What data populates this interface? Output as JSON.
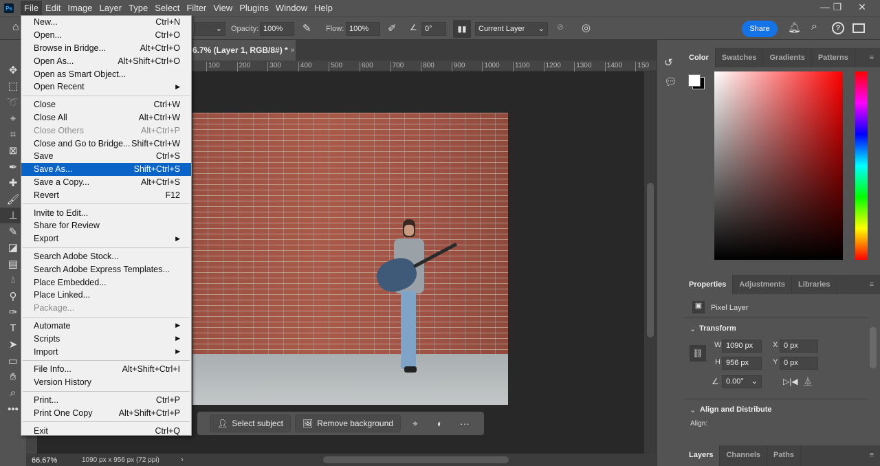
{
  "app": {
    "logo": "Ps"
  },
  "menubar": [
    "File",
    "Edit",
    "Image",
    "Layer",
    "Type",
    "Select",
    "Filter",
    "View",
    "Plugins",
    "Window",
    "Help"
  ],
  "window_controls": {
    "minimize": "—",
    "restore": "❐",
    "close": "✕"
  },
  "options": {
    "opacity_label": "Opacity:",
    "opacity": "100%",
    "flow_label": "Flow:",
    "flow": "100%",
    "angle": "0°",
    "sample": "Current Layer",
    "share": "Share"
  },
  "document": {
    "tab_title": "6.7% (Layer 1, RGB/8#) *",
    "close": "×"
  },
  "ruler": [
    "100",
    "200",
    "300",
    "400",
    "500",
    "600",
    "700",
    "800",
    "900",
    "1000",
    "1100",
    "1200",
    "1300",
    "1400",
    "150"
  ],
  "status": {
    "zoom": "66.67%",
    "info": "1090 px x 956 px (72 ppi)"
  },
  "context_bar": {
    "select_subject": "Select subject",
    "remove_background": "Remove background",
    "more": "···"
  },
  "color_panel": {
    "tabs": [
      "Color",
      "Swatches",
      "Gradients",
      "Patterns"
    ]
  },
  "properties": {
    "tabs": [
      "Properties",
      "Adjustments",
      "Libraries"
    ],
    "layer_type": "Pixel Layer",
    "transform": "Transform",
    "w_label": "W",
    "w": "1090 px",
    "h_label": "H",
    "h": "956 px",
    "x_label": "X",
    "x": "0 px",
    "y_label": "Y",
    "y": "0 px",
    "angle": "0.00°",
    "align_title": "Align and Distribute",
    "align_label": "Align:"
  },
  "layers_panel": {
    "tabs": [
      "Layers",
      "Channels",
      "Paths"
    ]
  },
  "file_menu": [
    {
      "label": "New...",
      "shortcut": "Ctrl+N"
    },
    {
      "label": "Open...",
      "shortcut": "Ctrl+O"
    },
    {
      "label": "Browse in Bridge...",
      "shortcut": "Alt+Ctrl+O"
    },
    {
      "label": "Open As...",
      "shortcut": "Alt+Shift+Ctrl+O"
    },
    {
      "label": "Open as Smart Object...",
      "shortcut": ""
    },
    {
      "label": "Open Recent",
      "shortcut": "",
      "submenu": true
    },
    {
      "sep": true
    },
    {
      "label": "Close",
      "shortcut": "Ctrl+W"
    },
    {
      "label": "Close All",
      "shortcut": "Alt+Ctrl+W"
    },
    {
      "label": "Close Others",
      "shortcut": "Alt+Ctrl+P",
      "disabled": true
    },
    {
      "label": "Close and Go to Bridge...",
      "shortcut": "Shift+Ctrl+W"
    },
    {
      "label": "Save",
      "shortcut": "Ctrl+S"
    },
    {
      "label": "Save As...",
      "shortcut": "Shift+Ctrl+S",
      "highlighted": true
    },
    {
      "label": "Save a Copy...",
      "shortcut": "Alt+Ctrl+S"
    },
    {
      "label": "Revert",
      "shortcut": "F12"
    },
    {
      "sep": true
    },
    {
      "label": "Invite to Edit...",
      "shortcut": ""
    },
    {
      "label": "Share for Review",
      "shortcut": ""
    },
    {
      "label": "Export",
      "shortcut": "",
      "submenu": true
    },
    {
      "sep": true
    },
    {
      "label": "Search Adobe Stock...",
      "shortcut": ""
    },
    {
      "label": "Search Adobe Express Templates...",
      "shortcut": ""
    },
    {
      "label": "Place Embedded...",
      "shortcut": ""
    },
    {
      "label": "Place Linked...",
      "shortcut": ""
    },
    {
      "label": "Package...",
      "shortcut": "",
      "disabled": true
    },
    {
      "sep": true
    },
    {
      "label": "Automate",
      "shortcut": "",
      "submenu": true
    },
    {
      "label": "Scripts",
      "shortcut": "",
      "submenu": true
    },
    {
      "label": "Import",
      "shortcut": "",
      "submenu": true
    },
    {
      "sep": true
    },
    {
      "label": "File Info...",
      "shortcut": "Alt+Shift+Ctrl+I"
    },
    {
      "label": "Version History",
      "shortcut": ""
    },
    {
      "sep": true
    },
    {
      "label": "Print...",
      "shortcut": "Ctrl+P"
    },
    {
      "label": "Print One Copy",
      "shortcut": "Alt+Shift+Ctrl+P"
    },
    {
      "sep": true
    },
    {
      "label": "Exit",
      "shortcut": "Ctrl+Q"
    }
  ]
}
